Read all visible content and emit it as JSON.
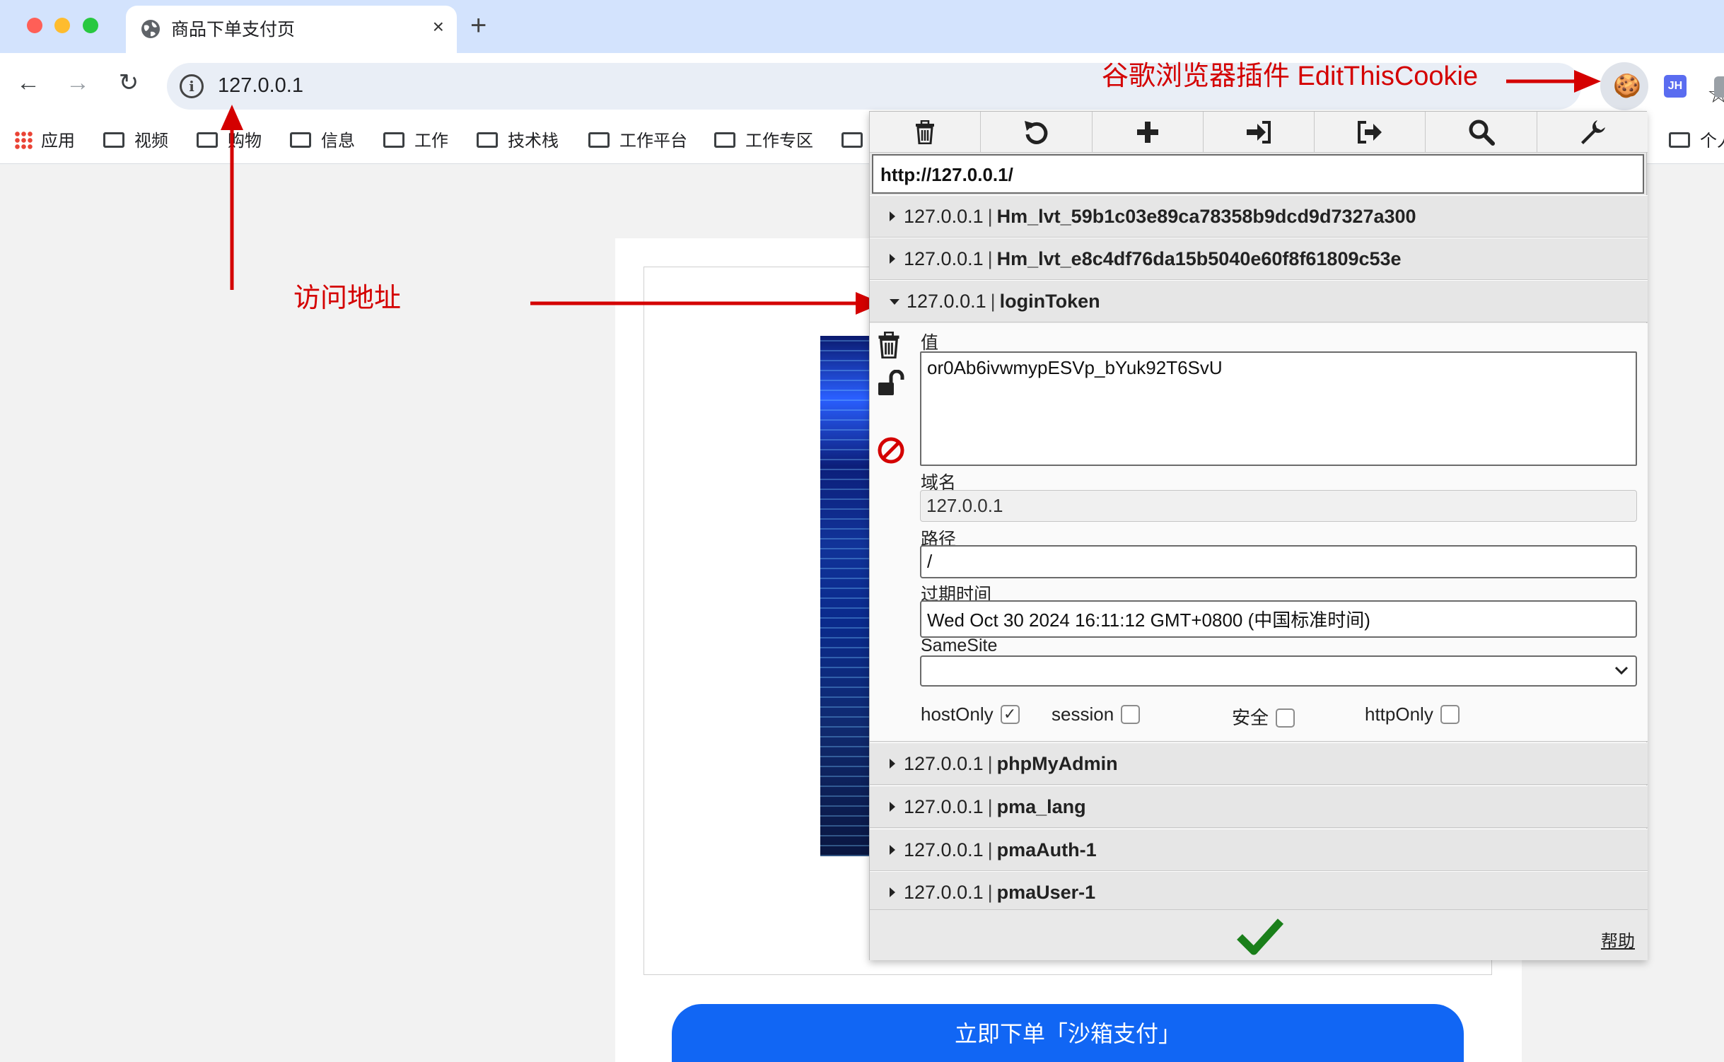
{
  "tab": {
    "title": "商品下单支付页",
    "close": "×",
    "new_tab": "+"
  },
  "nav": {
    "back": "←",
    "forward": "→",
    "reload": "↻"
  },
  "address": {
    "info": "i",
    "url": "127.0.0.1"
  },
  "star": "☆",
  "extensions": {
    "cookie_icon": "🍪",
    "jh_label": "JH"
  },
  "bookmarks": [
    {
      "label": "应用"
    },
    {
      "label": "视频"
    },
    {
      "label": "购物"
    },
    {
      "label": "信息"
    },
    {
      "label": "工作"
    },
    {
      "label": "技术栈"
    },
    {
      "label": "工作平台"
    },
    {
      "label": "工作专区"
    },
    {
      "label": ""
    },
    {
      "label": "个人"
    }
  ],
  "page": {
    "order_button": "立即下单「沙箱支付」"
  },
  "annotations": {
    "plugin_label": "谷歌浏览器插件 EditThisCookie",
    "address_label": "访问地址",
    "color": "#d40000"
  },
  "cookie_popup": {
    "url": "http://127.0.0.1/",
    "separator": "|",
    "cookies": [
      {
        "domain": "127.0.0.1",
        "name": "Hm_lvt_59b1c03e89ca78358b9dcd9d7327a300"
      },
      {
        "domain": "127.0.0.1",
        "name": "Hm_lvt_e8c4df76da15b5040e60f8f61809c53e"
      },
      {
        "domain": "127.0.0.1",
        "name": "loginToken"
      },
      {
        "domain": "127.0.0.1",
        "name": "phpMyAdmin"
      },
      {
        "domain": "127.0.0.1",
        "name": "pma_lang"
      },
      {
        "domain": "127.0.0.1",
        "name": "pmaAuth-1"
      },
      {
        "domain": "127.0.0.1",
        "name": "pmaUser-1"
      }
    ],
    "detail": {
      "value_label": "值",
      "value": "or0Ab6ivwmypESVp_bYuk92T6SvU",
      "domain_label": "域名",
      "domain": "127.0.0.1",
      "path_label": "路径",
      "path": "/",
      "expires_label": "过期时间",
      "expires": "Wed Oct 30 2024 16:11:12 GMT+0800 (中国标准时间)",
      "samesite_label": "SameSite",
      "samesite": "",
      "flags": [
        {
          "label": "hostOnly",
          "checked": true
        },
        {
          "label": "session",
          "checked": false
        },
        {
          "label": "安全",
          "checked": false
        },
        {
          "label": "httpOnly",
          "checked": false
        }
      ]
    },
    "help": "帮助",
    "colors": {
      "confirm": "#1a7f1a",
      "block": "#d40000"
    }
  }
}
